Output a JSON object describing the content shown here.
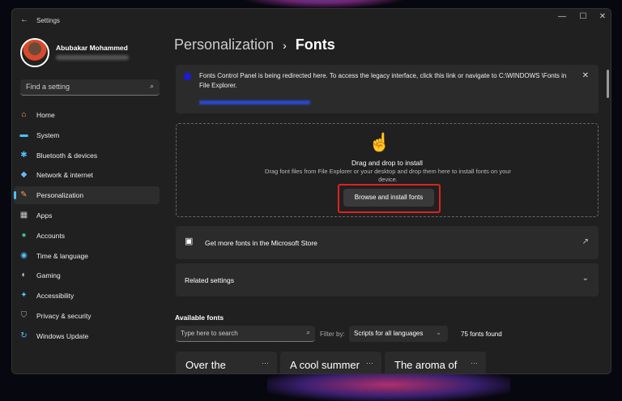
{
  "window": {
    "title": "Settings",
    "back_icon": "←",
    "minimize": "—",
    "maximize": "☐",
    "close": "✕"
  },
  "user": {
    "name": "Abubakar Mohammed"
  },
  "search": {
    "placeholder": "Find a setting"
  },
  "nav": [
    {
      "label": "Home",
      "icon": "⌂",
      "color": "#e0b070"
    },
    {
      "label": "System",
      "icon": "▬",
      "color": "#4cc2ff"
    },
    {
      "label": "Bluetooth & devices",
      "icon": "✱",
      "color": "#4cc2ff"
    },
    {
      "label": "Network & internet",
      "icon": "◆",
      "color": "#6ab8ff"
    },
    {
      "label": "Personalization",
      "icon": "✎",
      "color": "#f0a060"
    },
    {
      "label": "Apps",
      "icon": "▦",
      "color": "#ccc"
    },
    {
      "label": "Accounts",
      "icon": "●",
      "color": "#3cc08a"
    },
    {
      "label": "Time & language",
      "icon": "◉",
      "color": "#4cc2ff"
    },
    {
      "label": "Gaming",
      "icon": "◐",
      "color": "#ccc"
    },
    {
      "label": "Accessibility",
      "icon": "✦",
      "color": "#4cc2ff"
    },
    {
      "label": "Privacy & security",
      "icon": "⛉",
      "color": "#aaa"
    },
    {
      "label": "Windows Update",
      "icon": "↻",
      "color": "#4cc2ff"
    }
  ],
  "breadcrumb": {
    "parent": "Personalization",
    "separator": "›",
    "current": "Fonts"
  },
  "banner": {
    "text": "Fonts Control Panel is being redirected here. To access the legacy interface, click this link or navigate to C:\\WINDOWS \\Fonts in File Explorer.",
    "close": "✕"
  },
  "dropzone": {
    "title": "Drag and drop to install",
    "subtitle": "Drag font files from File Explorer or your desktop and drop them here to install fonts on your device.",
    "button": "Browse and install fonts"
  },
  "store": {
    "label": "Get more fonts in the Microsoft Store",
    "icon": "↗"
  },
  "related": {
    "label": "Related settings"
  },
  "available": {
    "heading": "Available fonts",
    "search_placeholder": "Type here to search",
    "filter_label": "Filter by:",
    "filter_value": "Scripts for all languages",
    "count": "75 fonts found"
  },
  "fonts": [
    {
      "preview": "Over the"
    },
    {
      "preview": "A cool summer"
    },
    {
      "preview": "The aroma of"
    }
  ]
}
